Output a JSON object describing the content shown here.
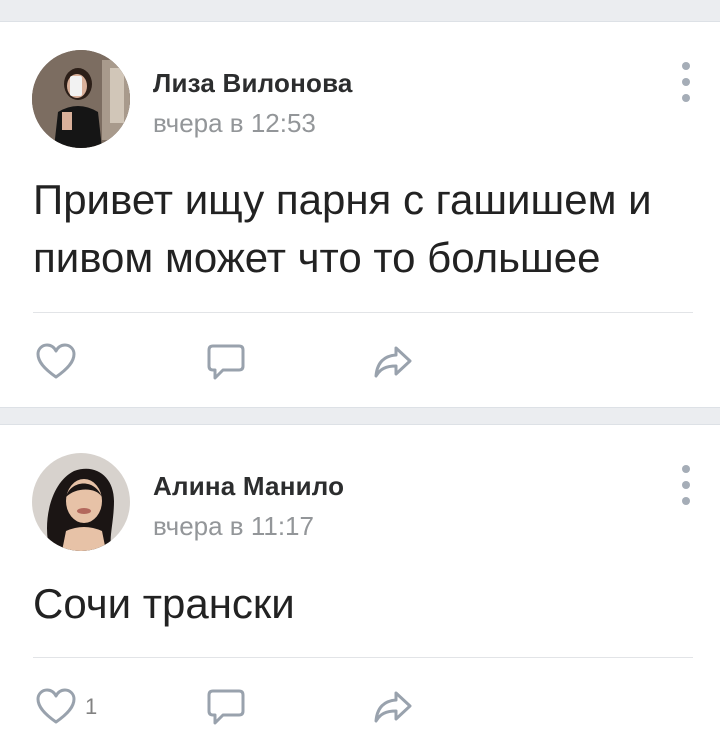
{
  "posts": [
    {
      "author": "Лиза Вилонова",
      "time": "вчера в 12:53",
      "text": "Привет ищу парня с гашишем и\nпивом может что то большее",
      "likes": ""
    },
    {
      "author": "Алина Манило",
      "time": "вчера в 11:17",
      "text": "Сочи трански",
      "likes": "1"
    }
  ],
  "colors": {
    "background": "#ebedf0",
    "card": "#ffffff",
    "text": "#222222",
    "meta": "#939699",
    "icon": "#99a2ad"
  },
  "icons": [
    "heart-icon",
    "comment-icon",
    "share-icon",
    "more-vertical-icon"
  ]
}
